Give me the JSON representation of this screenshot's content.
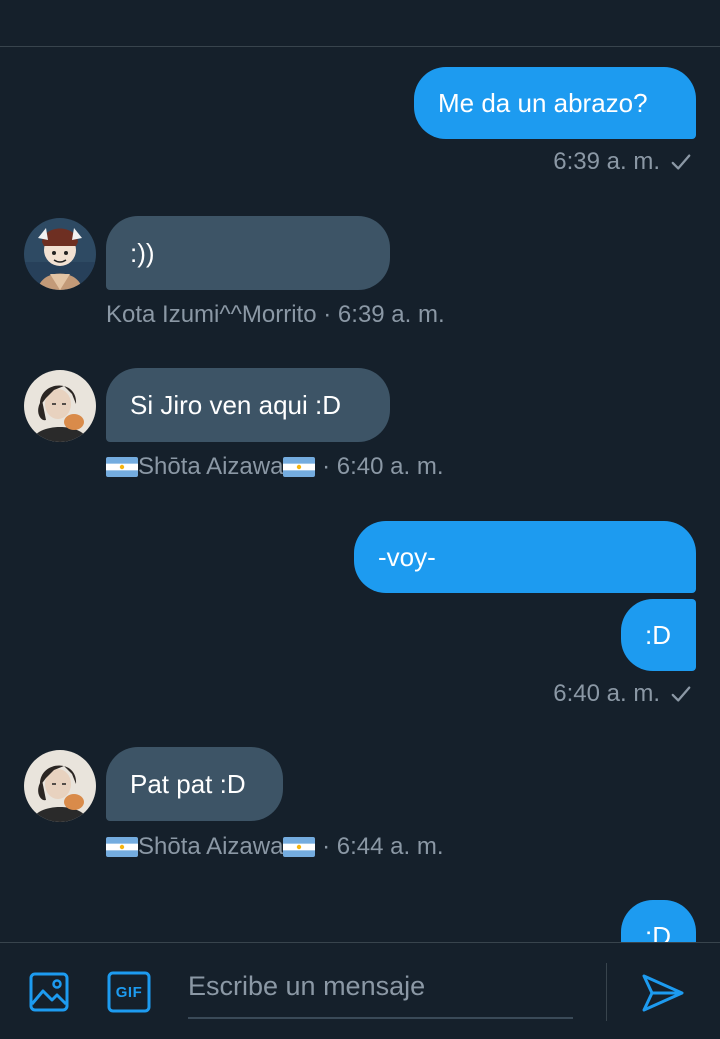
{
  "messages": [
    {
      "direction": "out",
      "text": "Me da un abrazo?",
      "meta": "6:39 a. m."
    },
    {
      "direction": "in",
      "text": ":))",
      "sender": "Kota Izumi^^Morrito",
      "time": "6:39 a. m."
    },
    {
      "direction": "in",
      "text": "Si Jiro ven aqui :D",
      "sender": "Shōta Aizawa",
      "time": "6:40 a. m."
    },
    {
      "direction": "out",
      "text": "-voy-"
    },
    {
      "direction": "out",
      "text": ":D",
      "meta": "6:40 a. m."
    },
    {
      "direction": "in",
      "text": "Pat pat :D",
      "sender": "Shōta Aizawa",
      "time": "6:44 a. m."
    },
    {
      "direction": "out",
      "text": ":D"
    }
  ],
  "separator": "·",
  "composer": {
    "placeholder": "Escribe un mensaje",
    "gif_label": "GIF"
  },
  "icons": {
    "image": "image-icon",
    "gif": "gif-icon",
    "send": "send-icon",
    "check": "check-icon",
    "flag": "argentina-flag-icon"
  },
  "colors": {
    "background": "#15202b",
    "outgoing_bubble": "#1d9bf0",
    "incoming_bubble": "#3d5466",
    "meta_text": "#8b98a5",
    "accent": "#1d9bf0"
  }
}
